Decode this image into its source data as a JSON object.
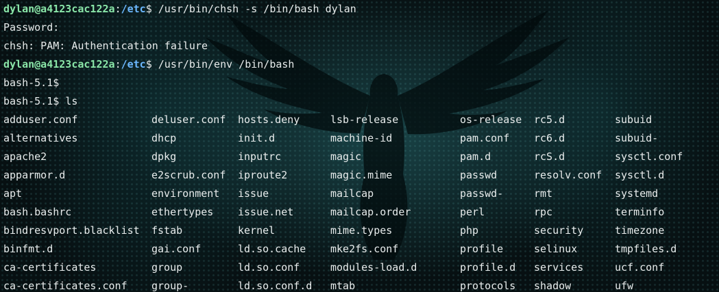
{
  "prompt": {
    "user_host": "dylan@a4123cac122a",
    "separator": ":",
    "cwd": "/etc",
    "symbol": "$"
  },
  "lines": {
    "cmd1": " /usr/bin/chsh -s /bin/bash dylan",
    "out1": "Password:",
    "out2": "chsh: PAM: Authentication failure",
    "cmd2": " /usr/bin/env /bin/bash",
    "bash1": "bash-5.1$",
    "bash2": "bash-5.1$ ls"
  },
  "ls_rows": [
    [
      "adduser.conf",
      "deluser.conf",
      "hosts.deny",
      "lsb-release",
      "os-release",
      "rc5.d",
      "subuid"
    ],
    [
      "alternatives",
      "dhcp",
      "init.d",
      "machine-id",
      "pam.conf",
      "rc6.d",
      "subuid-"
    ],
    [
      "apache2",
      "dpkg",
      "inputrc",
      "magic",
      "pam.d",
      "rcS.d",
      "sysctl.conf"
    ],
    [
      "apparmor.d",
      "e2scrub.conf",
      "iproute2",
      "magic.mime",
      "passwd",
      "resolv.conf",
      "sysctl.d"
    ],
    [
      "apt",
      "environment",
      "issue",
      "mailcap",
      "passwd-",
      "rmt",
      "systemd"
    ],
    [
      "bash.bashrc",
      "ethertypes",
      "issue.net",
      "mailcap.order",
      "perl",
      "rpc",
      "terminfo"
    ],
    [
      "bindresvport.blacklist",
      "fstab",
      "kernel",
      "mime.types",
      "php",
      "security",
      "timezone"
    ],
    [
      "binfmt.d",
      "gai.conf",
      "ld.so.cache",
      "mke2fs.conf",
      "profile",
      "selinux",
      "tmpfiles.d"
    ],
    [
      "ca-certificates",
      "group",
      "ld.so.conf",
      "modules-load.d",
      "profile.d",
      "services",
      "ucf.conf"
    ],
    [
      "ca-certificates.conf",
      "group-",
      "ld.so.conf.d",
      "mtab",
      "protocols",
      "shadow",
      "ufw"
    ]
  ],
  "colors": {
    "username": "#8ae6a8",
    "path": "#6cb8ff",
    "text": "#e8ecec",
    "background": "#071012"
  }
}
